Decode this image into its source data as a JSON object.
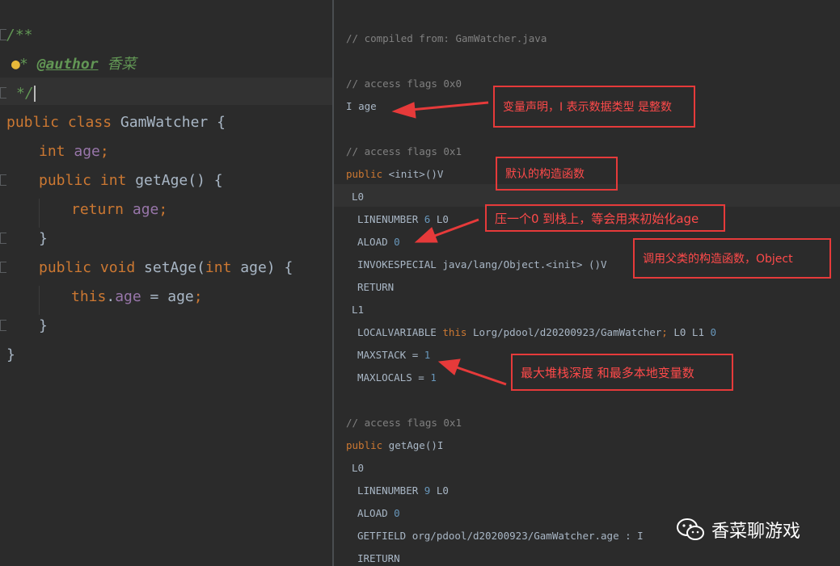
{
  "source_editor": {
    "lines": {
      "doc_open": "/**",
      "author_prefix": "* ",
      "author_tag": "@author",
      "author_name": "香菜",
      "doc_close": "*/",
      "class_kw": "public class ",
      "class_name": "GamWatcher {",
      "int_kw": "int",
      "field_age": "age",
      "semi": ";",
      "getter_mod": "public int ",
      "getter_name": "getAge",
      "getter_sig": "() {",
      "return_kw": "return",
      "close_brace": "}",
      "setter_mod": "public void ",
      "setter_name": "setAge",
      "setter_params_open": "(",
      "setter_params_close": " age) {",
      "this_kw": "this",
      "dot": ".",
      "assign": " = age",
      "class_close": "}"
    }
  },
  "bytecode_viewer": {
    "compiled_from": "// compiled from: GamWatcher.java",
    "flags_0x0": "// access flags 0x0",
    "field_decl_prefix": "I ",
    "field_decl_name": "age",
    "flags_0x1_a": "// access flags 0x1",
    "ctor_kw": "public",
    "ctor_sig": " <init>()V",
    "label_l0_a": "L0",
    "linenumber_6_prefix": "LINENUMBER ",
    "linenumber_6_num": "6",
    "linenumber_6_suffix": " L0",
    "aload_prefix": "ALOAD ",
    "aload_num": "0",
    "invokespecial": "INVOKESPECIAL java/lang/Object.<init> ()V",
    "return": "RETURN",
    "label_l1": "L1",
    "localvar_prefix": "LOCALVARIABLE ",
    "localvar_this": "this",
    "localvar_mid": " Lorg/pdool/d20200923/GamWatcher",
    "localvar_semi": ";",
    "localvar_tail": " L0 L1 ",
    "localvar_num": "0",
    "maxstack_prefix": "MAXSTACK = ",
    "maxstack_num": "1",
    "maxlocals_prefix": "MAXLOCALS = ",
    "maxlocals_num": "1",
    "flags_0x1_b": "// access flags 0x1",
    "getter_kw": "public",
    "getter_sig": " getAge()I",
    "label_l0_b": "L0",
    "linenumber_9_prefix": "LINENUMBER ",
    "linenumber_9_num": "9",
    "linenumber_9_suffix": " L0",
    "aload2_prefix": "ALOAD ",
    "aload2_num": "0",
    "getfield": "GETFIELD org/pdool/d20200923/GamWatcher.age : I",
    "ireturn": "IRETURN"
  },
  "annotations": {
    "field_note": "变量声明，I 表示数据类型 是整数",
    "ctor_note": "默认的构造函数",
    "push_note": "压一个0 到栈上，等会用来初始化age",
    "super_note": "调用父类的构造函数，Object",
    "stack_note": "最大堆栈深度 和最多本地变量数"
  },
  "watermark": {
    "text": "香菜聊游戏",
    "icon": "wechat-icon"
  },
  "colors": {
    "annotation_red": "#e63a3a",
    "keyword_orange": "#cc7832",
    "field_purple": "#9876aa",
    "comment_green": "#629755",
    "number_blue": "#6897bb"
  }
}
